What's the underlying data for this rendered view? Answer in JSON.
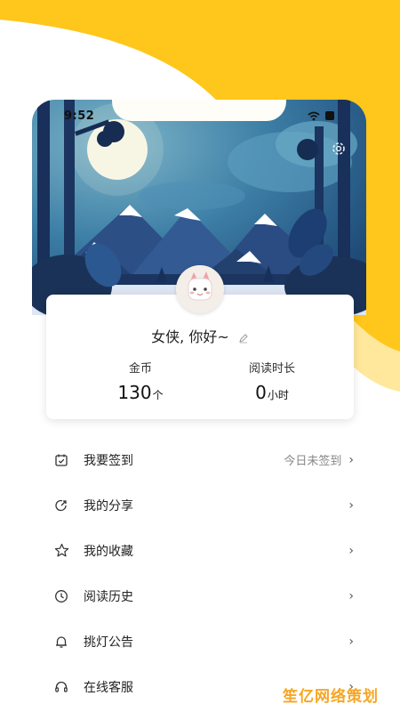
{
  "status_bar": {
    "time": "9:52"
  },
  "profile": {
    "greeting": "女侠, 你好~",
    "stats": [
      {
        "label": "金币",
        "value": "130",
        "unit": "个"
      },
      {
        "label": "阅读时长",
        "value": "0",
        "unit": "小时"
      }
    ]
  },
  "menu": {
    "items": [
      {
        "label": "我要签到",
        "status": "今日未签到",
        "icon": "calendar-check-icon"
      },
      {
        "label": "我的分享",
        "status": "",
        "icon": "share-icon"
      },
      {
        "label": "我的收藏",
        "status": "",
        "icon": "star-icon"
      },
      {
        "label": "阅读历史",
        "status": "",
        "icon": "clock-icon"
      },
      {
        "label": "挑灯公告",
        "status": "",
        "icon": "bell-icon"
      },
      {
        "label": "在线客服",
        "status": "",
        "icon": "headset-icon"
      }
    ],
    "chevron": "›"
  },
  "watermark": "笙亿网络策划",
  "colors": {
    "accent_yellow": "#ffc61b",
    "night_sky": "#2a5f8f"
  }
}
